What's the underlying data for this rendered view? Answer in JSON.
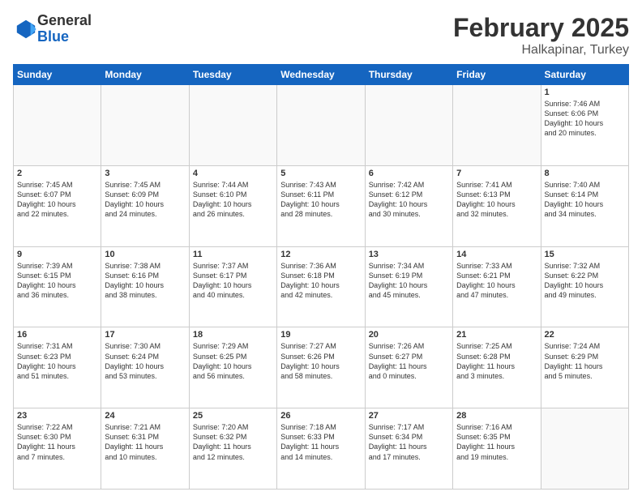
{
  "logo": {
    "general": "General",
    "blue": "Blue"
  },
  "title": "February 2025",
  "subtitle": "Halkapinar, Turkey",
  "days_header": [
    "Sunday",
    "Monday",
    "Tuesday",
    "Wednesday",
    "Thursday",
    "Friday",
    "Saturday"
  ],
  "weeks": [
    [
      {
        "day": "",
        "info": ""
      },
      {
        "day": "",
        "info": ""
      },
      {
        "day": "",
        "info": ""
      },
      {
        "day": "",
        "info": ""
      },
      {
        "day": "",
        "info": ""
      },
      {
        "day": "",
        "info": ""
      },
      {
        "day": "1",
        "info": "Sunrise: 7:46 AM\nSunset: 6:06 PM\nDaylight: 10 hours\nand 20 minutes."
      }
    ],
    [
      {
        "day": "2",
        "info": "Sunrise: 7:45 AM\nSunset: 6:07 PM\nDaylight: 10 hours\nand 22 minutes."
      },
      {
        "day": "3",
        "info": "Sunrise: 7:45 AM\nSunset: 6:09 PM\nDaylight: 10 hours\nand 24 minutes."
      },
      {
        "day": "4",
        "info": "Sunrise: 7:44 AM\nSunset: 6:10 PM\nDaylight: 10 hours\nand 26 minutes."
      },
      {
        "day": "5",
        "info": "Sunrise: 7:43 AM\nSunset: 6:11 PM\nDaylight: 10 hours\nand 28 minutes."
      },
      {
        "day": "6",
        "info": "Sunrise: 7:42 AM\nSunset: 6:12 PM\nDaylight: 10 hours\nand 30 minutes."
      },
      {
        "day": "7",
        "info": "Sunrise: 7:41 AM\nSunset: 6:13 PM\nDaylight: 10 hours\nand 32 minutes."
      },
      {
        "day": "8",
        "info": "Sunrise: 7:40 AM\nSunset: 6:14 PM\nDaylight: 10 hours\nand 34 minutes."
      }
    ],
    [
      {
        "day": "9",
        "info": "Sunrise: 7:39 AM\nSunset: 6:15 PM\nDaylight: 10 hours\nand 36 minutes."
      },
      {
        "day": "10",
        "info": "Sunrise: 7:38 AM\nSunset: 6:16 PM\nDaylight: 10 hours\nand 38 minutes."
      },
      {
        "day": "11",
        "info": "Sunrise: 7:37 AM\nSunset: 6:17 PM\nDaylight: 10 hours\nand 40 minutes."
      },
      {
        "day": "12",
        "info": "Sunrise: 7:36 AM\nSunset: 6:18 PM\nDaylight: 10 hours\nand 42 minutes."
      },
      {
        "day": "13",
        "info": "Sunrise: 7:34 AM\nSunset: 6:19 PM\nDaylight: 10 hours\nand 45 minutes."
      },
      {
        "day": "14",
        "info": "Sunrise: 7:33 AM\nSunset: 6:21 PM\nDaylight: 10 hours\nand 47 minutes."
      },
      {
        "day": "15",
        "info": "Sunrise: 7:32 AM\nSunset: 6:22 PM\nDaylight: 10 hours\nand 49 minutes."
      }
    ],
    [
      {
        "day": "16",
        "info": "Sunrise: 7:31 AM\nSunset: 6:23 PM\nDaylight: 10 hours\nand 51 minutes."
      },
      {
        "day": "17",
        "info": "Sunrise: 7:30 AM\nSunset: 6:24 PM\nDaylight: 10 hours\nand 53 minutes."
      },
      {
        "day": "18",
        "info": "Sunrise: 7:29 AM\nSunset: 6:25 PM\nDaylight: 10 hours\nand 56 minutes."
      },
      {
        "day": "19",
        "info": "Sunrise: 7:27 AM\nSunset: 6:26 PM\nDaylight: 10 hours\nand 58 minutes."
      },
      {
        "day": "20",
        "info": "Sunrise: 7:26 AM\nSunset: 6:27 PM\nDaylight: 11 hours\nand 0 minutes."
      },
      {
        "day": "21",
        "info": "Sunrise: 7:25 AM\nSunset: 6:28 PM\nDaylight: 11 hours\nand 3 minutes."
      },
      {
        "day": "22",
        "info": "Sunrise: 7:24 AM\nSunset: 6:29 PM\nDaylight: 11 hours\nand 5 minutes."
      }
    ],
    [
      {
        "day": "23",
        "info": "Sunrise: 7:22 AM\nSunset: 6:30 PM\nDaylight: 11 hours\nand 7 minutes."
      },
      {
        "day": "24",
        "info": "Sunrise: 7:21 AM\nSunset: 6:31 PM\nDaylight: 11 hours\nand 10 minutes."
      },
      {
        "day": "25",
        "info": "Sunrise: 7:20 AM\nSunset: 6:32 PM\nDaylight: 11 hours\nand 12 minutes."
      },
      {
        "day": "26",
        "info": "Sunrise: 7:18 AM\nSunset: 6:33 PM\nDaylight: 11 hours\nand 14 minutes."
      },
      {
        "day": "27",
        "info": "Sunrise: 7:17 AM\nSunset: 6:34 PM\nDaylight: 11 hours\nand 17 minutes."
      },
      {
        "day": "28",
        "info": "Sunrise: 7:16 AM\nSunset: 6:35 PM\nDaylight: 11 hours\nand 19 minutes."
      },
      {
        "day": "",
        "info": ""
      }
    ]
  ]
}
